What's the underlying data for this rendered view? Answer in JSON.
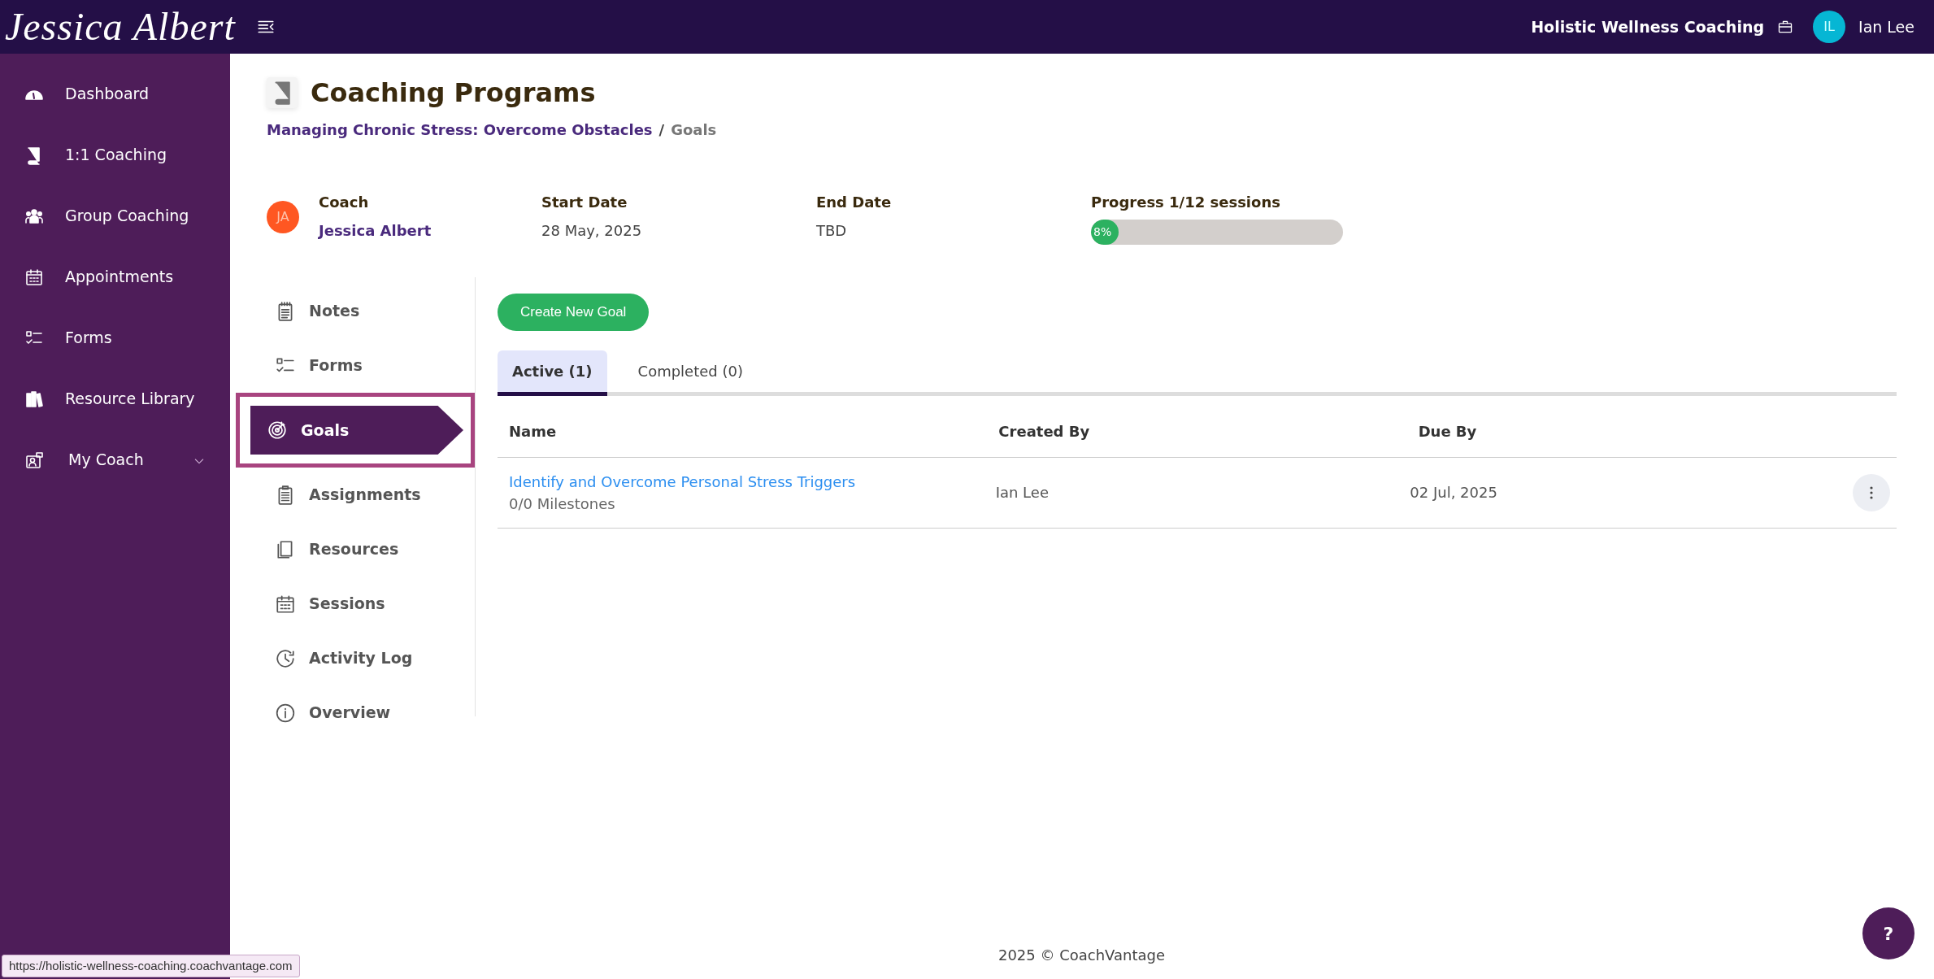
{
  "top_bar": {
    "logo": "Jessica Albert",
    "organization": "Holistic Wellness Coaching",
    "user": {
      "initials": "IL",
      "name": "Ian Lee"
    }
  },
  "sidebar": {
    "items": [
      {
        "label": "Dashboard",
        "selected": false
      },
      {
        "label": "1:1 Coaching",
        "selected": false
      },
      {
        "label": "Group Coaching",
        "selected": false
      },
      {
        "label": "Appointments",
        "selected": false
      },
      {
        "label": "Forms",
        "selected": false
      },
      {
        "label": "Resource Library",
        "selected": false
      },
      {
        "label": "My Coach",
        "selected": false,
        "expanded": false
      }
    ]
  },
  "page": {
    "title": "Coaching Programs",
    "breadcrumb_separator": "/",
    "breadcrumb": [
      {
        "label": "Managing Chronic Stress: Overcome Obstacles",
        "link": true
      },
      {
        "label": "Goals",
        "link": false
      }
    ]
  },
  "program_info": {
    "coach": {
      "initials": "JA",
      "label": "Coach",
      "name": "Jessica Albert"
    },
    "start": {
      "label": "Start Date",
      "value": "28 May, 2025"
    },
    "end": {
      "label": "End Date",
      "value": "TBD"
    },
    "progress": {
      "label": "Progress 1/12 sessions",
      "level": 0.08,
      "reading": "8%"
    }
  },
  "sub_nav": {
    "items": [
      {
        "label": "Notes",
        "selected": false,
        "highlighted": false
      },
      {
        "label": "Forms",
        "selected": false,
        "highlighted": false
      },
      {
        "label": "Goals",
        "selected": true,
        "highlighted": true
      },
      {
        "label": "Assignments",
        "selected": false,
        "highlighted": false
      },
      {
        "label": "Resources",
        "selected": false,
        "highlighted": false
      },
      {
        "label": "Sessions",
        "selected": false,
        "highlighted": false
      },
      {
        "label": "Activity Log",
        "selected": false,
        "highlighted": false
      },
      {
        "label": "Overview",
        "selected": false,
        "highlighted": false
      }
    ]
  },
  "create_button": "Create New Goal",
  "tabs": [
    {
      "label": "Active (1)",
      "selected": true
    },
    {
      "label": "Completed (0)",
      "selected": false
    }
  ],
  "table": {
    "columns": [
      "Name",
      "Created By",
      "Due By"
    ],
    "rows": [
      {
        "name": "Identify and Overcome Personal Stress Triggers",
        "milestones": "0/0 Milestones",
        "created_by": "Ian Lee",
        "due_by": "02 Jul, 2025"
      }
    ]
  },
  "footer": "2025 © CoachVantage",
  "help_button": "?",
  "status_link": "https://holistic-wellness-coaching.coachvantage.com"
}
